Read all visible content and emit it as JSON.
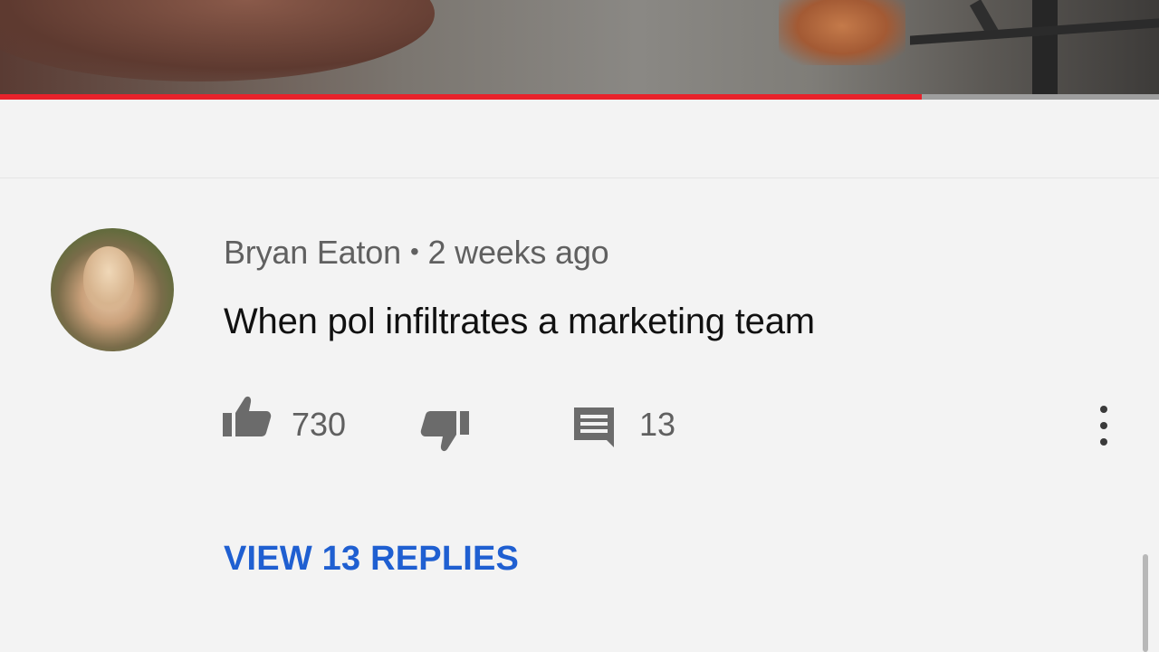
{
  "video": {
    "progress_percent": 79.5,
    "accent_color": "#e8222b"
  },
  "comment": {
    "author": "Bryan Eaton",
    "separator": "•",
    "time": "2 weeks ago",
    "text": "When pol infiltrates a marketing team",
    "likes": "730",
    "replies": "13",
    "view_replies_label": "VIEW 13 REPLIES",
    "link_color": "#1f5fd1"
  },
  "icons": {
    "like": "thumbs-up-icon",
    "dislike": "thumbs-down-icon",
    "reply": "comment-icon",
    "more": "more-vert-icon"
  }
}
